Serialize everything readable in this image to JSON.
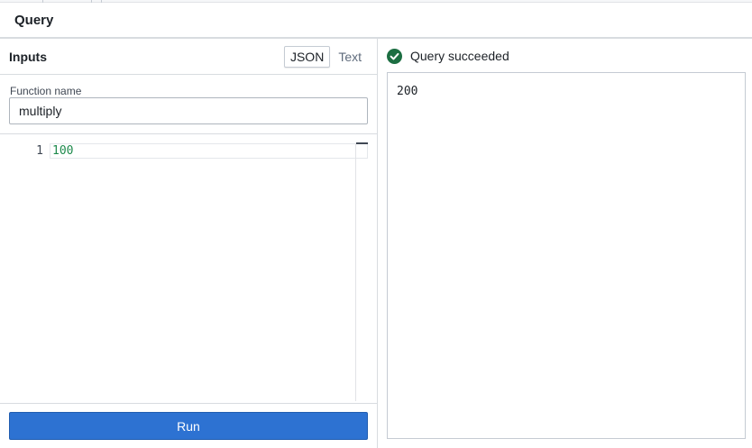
{
  "header": {
    "title": "Query"
  },
  "inputs": {
    "label": "Inputs",
    "modes": [
      "JSON",
      "Text"
    ],
    "active_mode": "JSON"
  },
  "function": {
    "label": "Function name",
    "value": "multiply"
  },
  "editor": {
    "line_number": "1",
    "code": "100"
  },
  "run": {
    "label": "Run"
  },
  "result": {
    "status": "Query succeeded",
    "output": "200"
  },
  "colors": {
    "accent": "#2d72d2",
    "success": "#1c6e42",
    "code_number": "#1e8a4c"
  }
}
